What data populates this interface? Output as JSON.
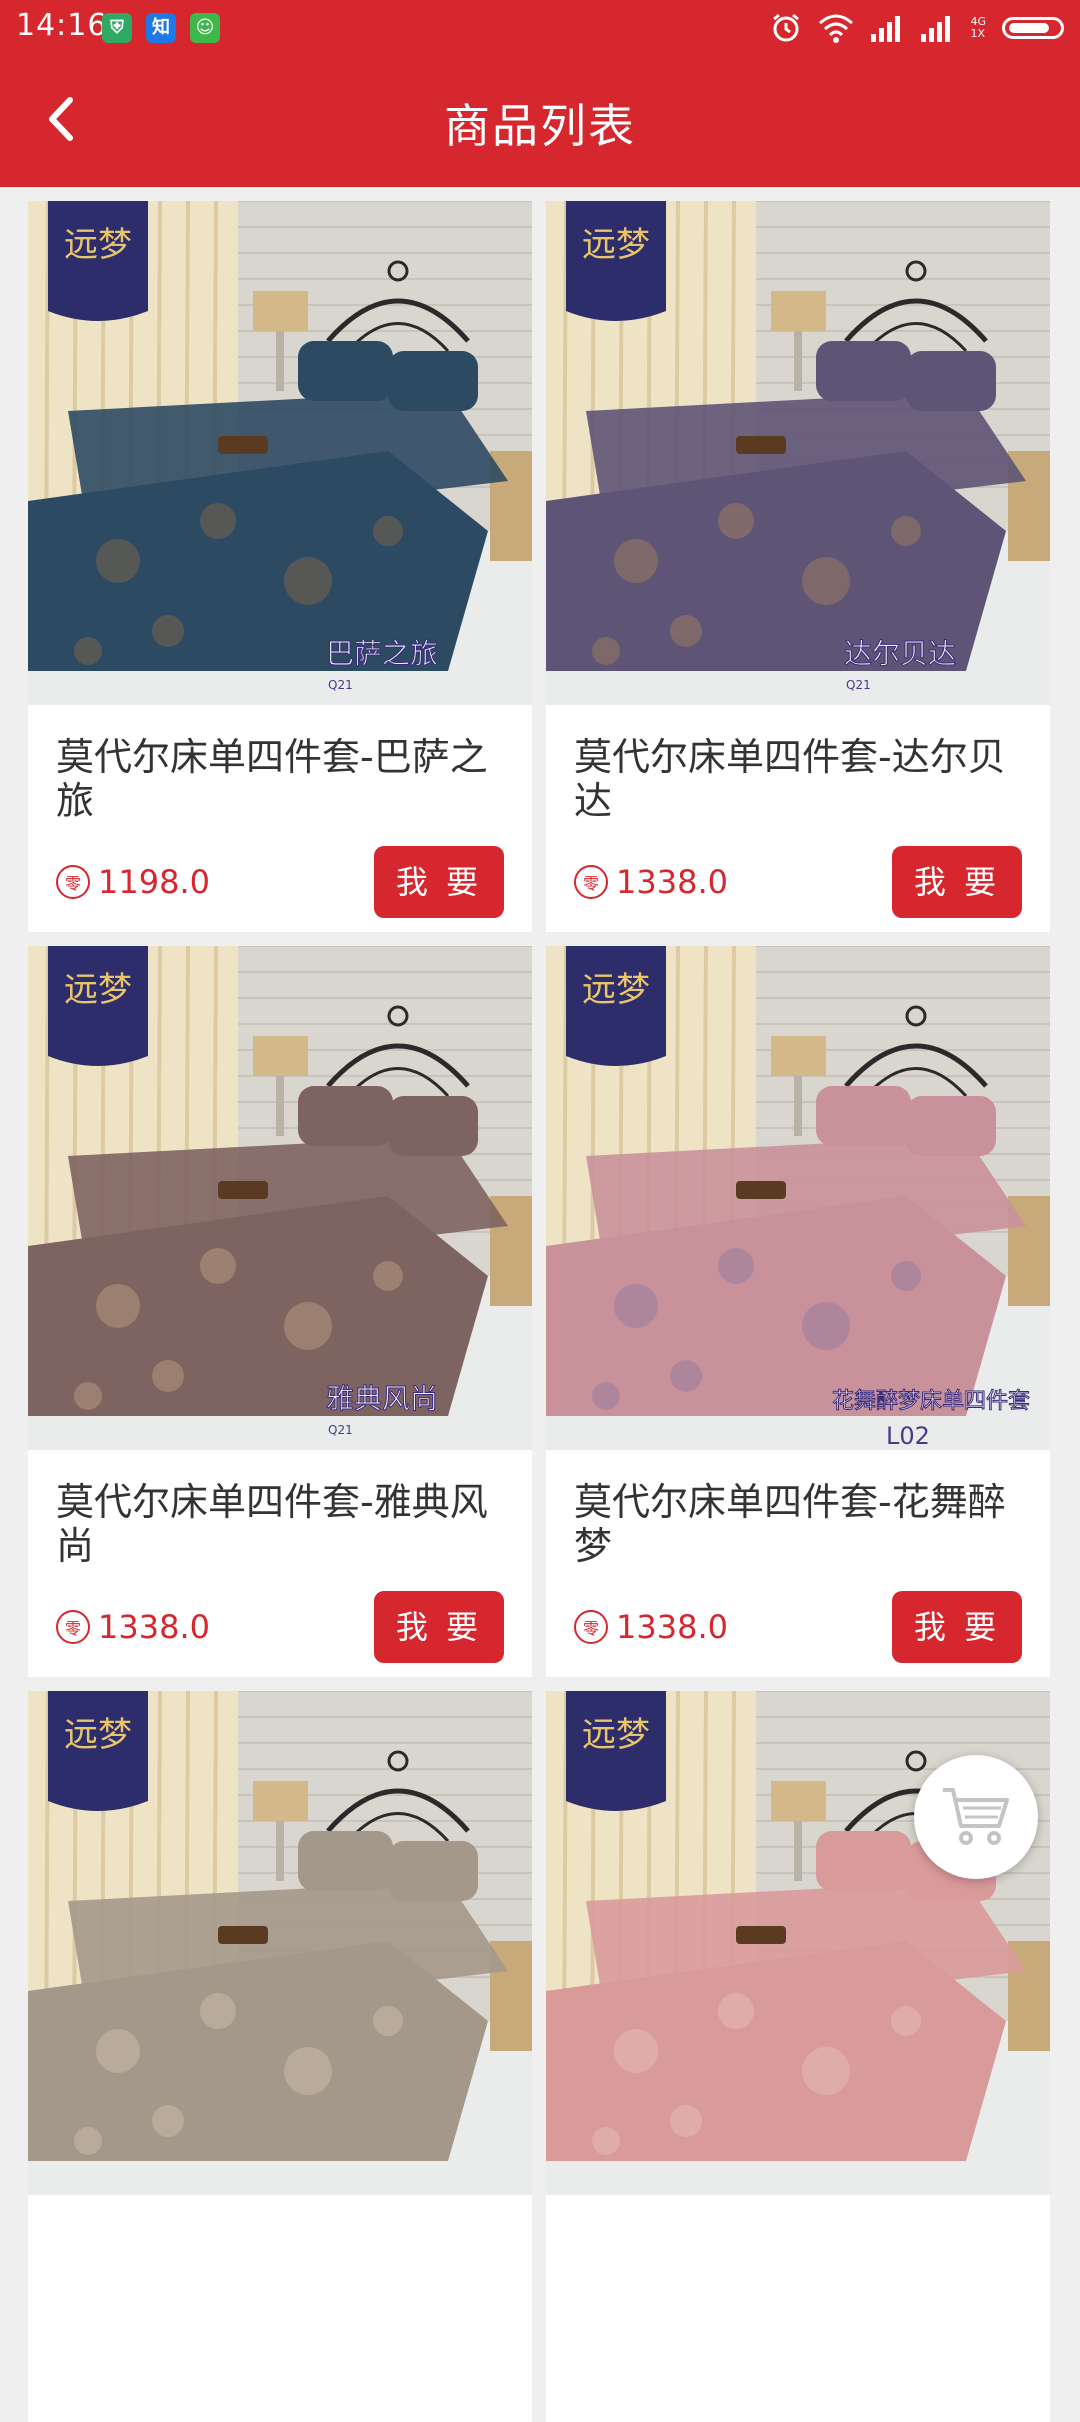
{
  "status_bar": {
    "time": "14:16",
    "apps": [
      {
        "icon": "shield-app-icon",
        "glyph": "⛨",
        "color": "#2eaa63"
      },
      {
        "icon": "zhihu-app-icon",
        "glyph": "知",
        "color": "#1e78e6"
      },
      {
        "icon": "android-app-icon",
        "glyph": "☺",
        "color": "#3fb84b"
      }
    ],
    "network": "4G",
    "network_sub": "1X"
  },
  "header": {
    "title": "商品列表",
    "back_icon": "chevron-left-icon"
  },
  "products": [
    {
      "name": "莫代尔床单四件套-巴萨之旅",
      "price": "1198.0",
      "buy_label": "我 要",
      "image_caption": "巴萨之旅",
      "image_code": "Q21",
      "bedding_color": "#2d4a63",
      "bedding_accent": "#8a6a47",
      "brand": "远梦"
    },
    {
      "name": "莫代尔床单四件套-达尔贝达",
      "price": "1338.0",
      "buy_label": "我 要",
      "image_caption": "达尔贝达",
      "image_code": "Q21",
      "bedding_color": "#5e5475",
      "bedding_accent": "#a7835d",
      "brand": "远梦"
    },
    {
      "name": "莫代尔床单四件套-雅典风尚",
      "price": "1338.0",
      "buy_label": "我 要",
      "image_caption": "雅典风尚",
      "image_code": "Q21",
      "bedding_color": "#7e6461",
      "bedding_accent": "#c0a184",
      "brand": "远梦"
    },
    {
      "name": "莫代尔床单四件套-花舞醉梦",
      "price": "1338.0",
      "buy_label": "我 要",
      "image_caption": "花舞醉梦床单四件套",
      "image_code": "L02",
      "bedding_color": "#c9919a",
      "bedding_accent": "#8c7aa0",
      "brand": "远梦"
    },
    {
      "name": "",
      "price": "",
      "buy_label": "",
      "image_caption": "",
      "image_code": "",
      "bedding_color": "#a4988a",
      "bedding_accent": "#d2c3ad",
      "brand": "远梦"
    },
    {
      "name": "",
      "price": "",
      "buy_label": "",
      "image_caption": "",
      "image_code": "",
      "bedding_color": "#d99a9a",
      "bedding_accent": "#e9c3bd",
      "brand": "远梦"
    }
  ],
  "price_icon_glyph": "零",
  "cart_button": {
    "icon": "shopping-cart-icon"
  },
  "colors": {
    "accent": "#d6262e",
    "background": "#efefef"
  }
}
